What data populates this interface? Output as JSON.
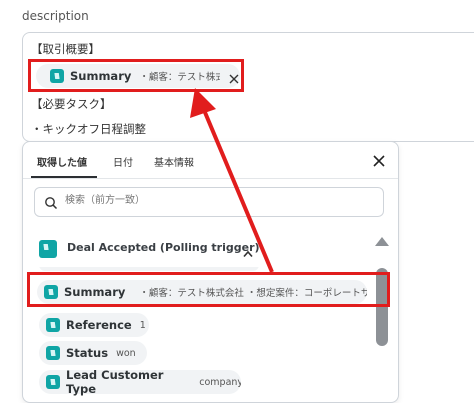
{
  "description": {
    "label": "description",
    "line1": "【取引概要】",
    "chip": {
      "main": "Summary",
      "sub": "・顧客：テスト株式会..."
    },
    "line2": "【必要タスク】",
    "line3": "・キックオフ日程調整"
  },
  "panel": {
    "tabs": [
      "取得した値",
      "日付",
      "基本情報"
    ],
    "search_placeholder": "検索（前方一致）",
    "section_title": "Deal Accepted (Polling trigger)",
    "items": [
      {
        "main": "Summary",
        "sub": "・顧客：テスト株式会社 ・想定案件：コーポレートサイ..."
      },
      {
        "main": "Reference",
        "sub": "1"
      },
      {
        "main": "Status",
        "sub": "won"
      },
      {
        "main": "Lead Customer Type",
        "sub": "company"
      }
    ]
  },
  "colors": {
    "accent_red": "#e11d1d",
    "logo_teal": "#10a5a5"
  },
  "icons": [
    "close-icon",
    "search-icon",
    "chevron-up-icon",
    "scroll-up-icon"
  ]
}
